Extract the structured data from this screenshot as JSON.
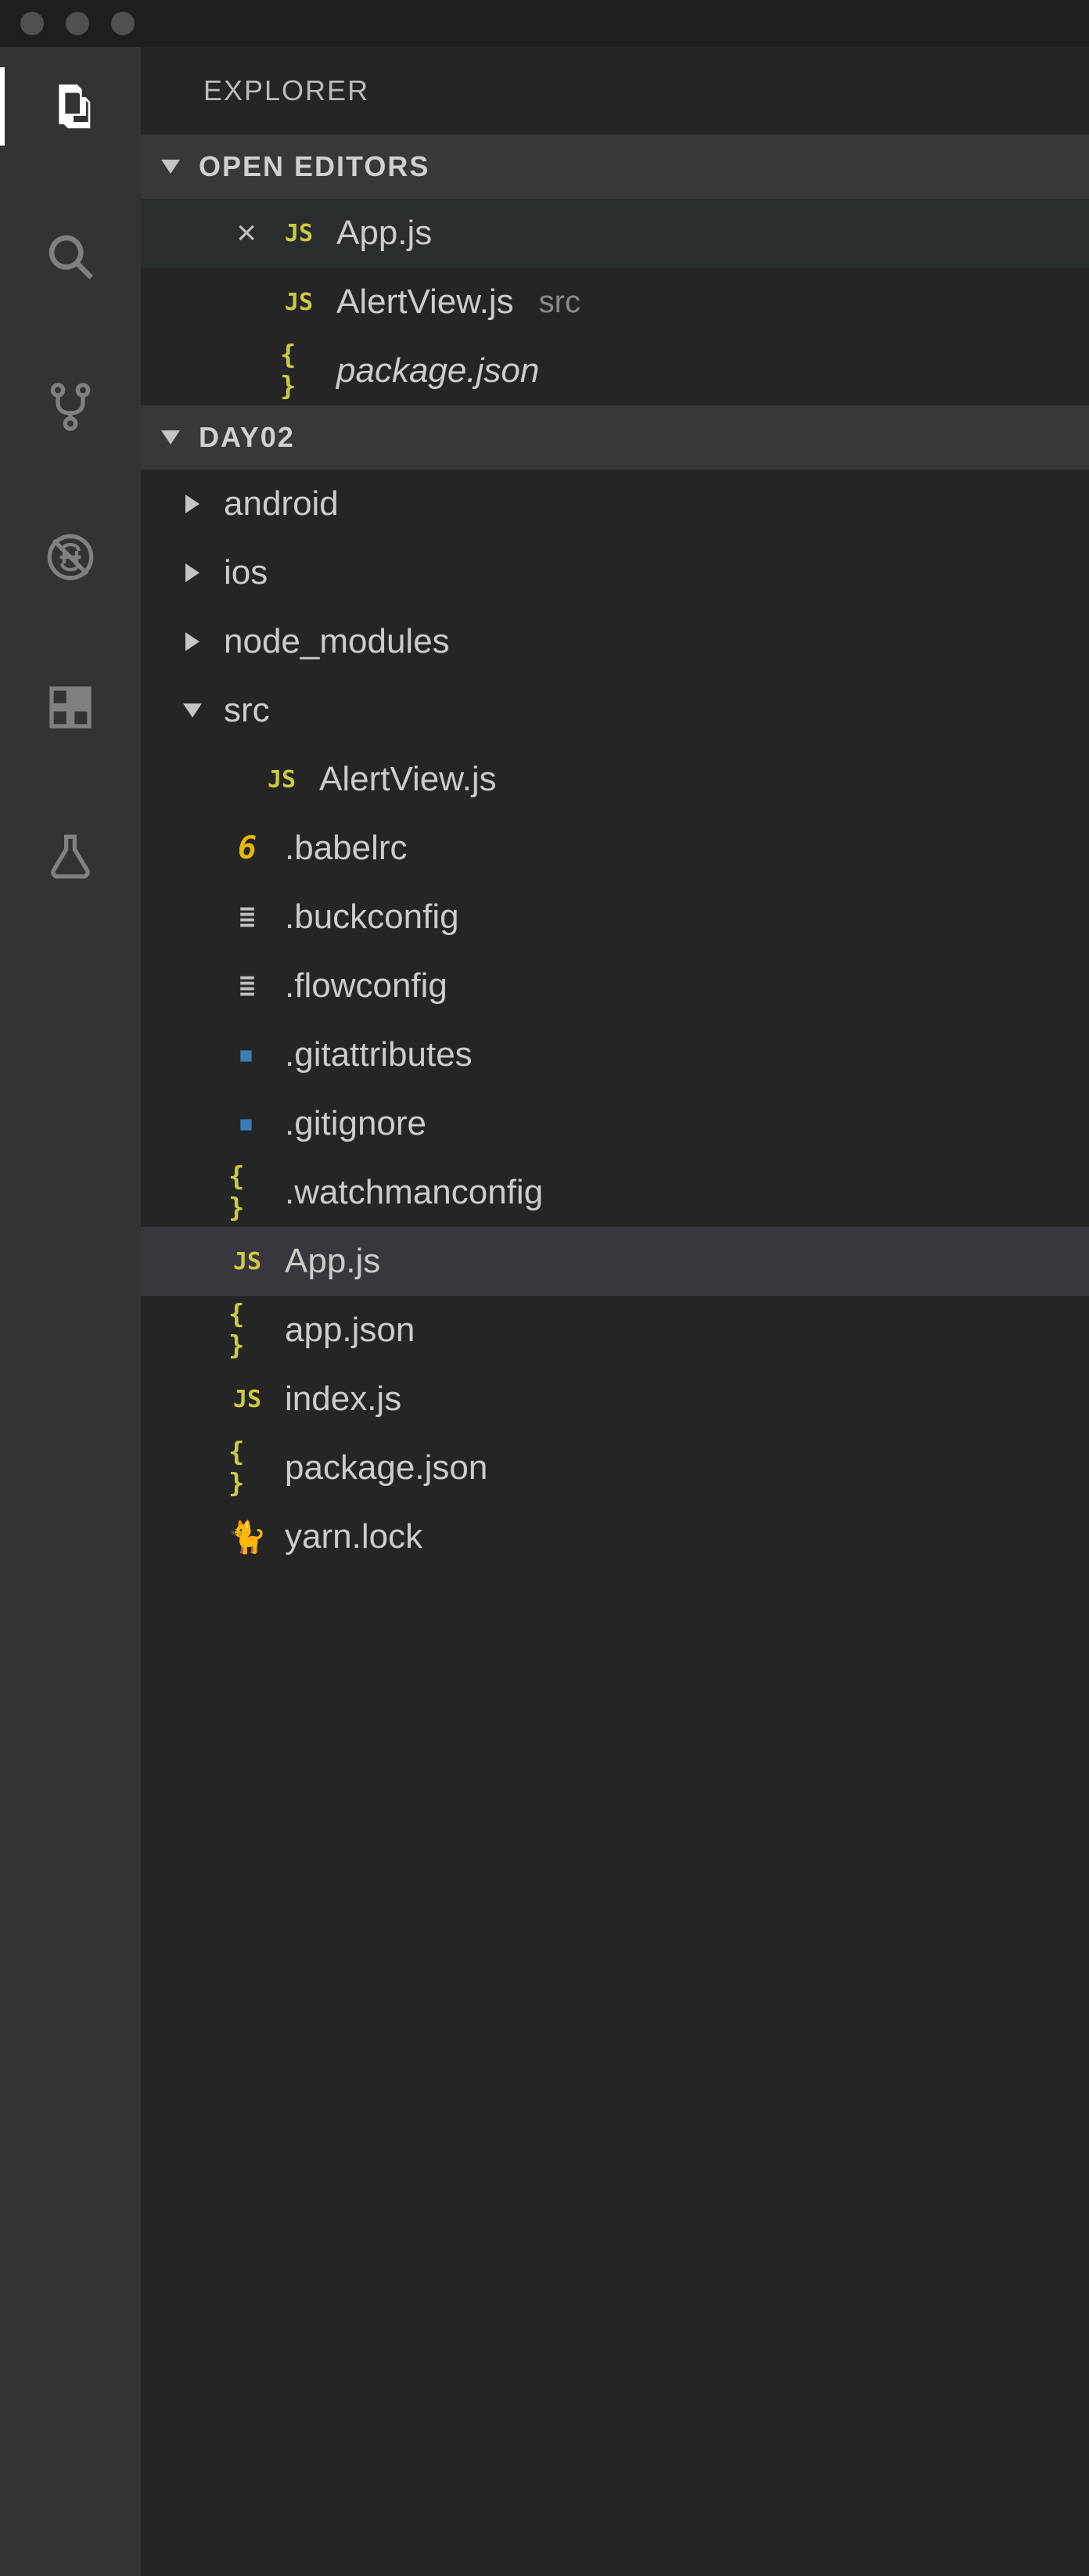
{
  "titlebar": {
    "title": ""
  },
  "activitybar": {
    "items": [
      {
        "name": "explorer",
        "active": true
      },
      {
        "name": "search",
        "active": false
      },
      {
        "name": "source-control",
        "active": false
      },
      {
        "name": "debug",
        "active": false
      },
      {
        "name": "extensions",
        "active": false
      },
      {
        "name": "beaker",
        "active": false
      }
    ]
  },
  "sidebar": {
    "title": "EXPLORER",
    "openEditors": {
      "label": "OPEN EDITORS",
      "items": [
        {
          "icon": "js",
          "name": "App.js",
          "dir": "",
          "dirty": false,
          "active": true,
          "italic": false
        },
        {
          "icon": "js",
          "name": "AlertView.js",
          "dir": "src",
          "dirty": false,
          "active": false,
          "italic": false
        },
        {
          "icon": "json",
          "name": "package.json",
          "dir": "",
          "dirty": false,
          "active": false,
          "italic": true
        }
      ]
    },
    "project": {
      "label": "DAY02",
      "tree": [
        {
          "type": "folder",
          "name": "android",
          "expanded": false,
          "depth": 0
        },
        {
          "type": "folder",
          "name": "ios",
          "expanded": false,
          "depth": 0
        },
        {
          "type": "folder",
          "name": "node_modules",
          "expanded": false,
          "depth": 0
        },
        {
          "type": "folder",
          "name": "src",
          "expanded": true,
          "depth": 0
        },
        {
          "type": "file",
          "name": "AlertView.js",
          "icon": "js",
          "depth": 1,
          "selected": false
        },
        {
          "type": "file",
          "name": ".babelrc",
          "icon": "babel",
          "depth": 0,
          "selected": false
        },
        {
          "type": "file",
          "name": ".buckconfig",
          "icon": "lines",
          "depth": 0,
          "selected": false
        },
        {
          "type": "file",
          "name": ".flowconfig",
          "icon": "lines",
          "depth": 0,
          "selected": false
        },
        {
          "type": "file",
          "name": ".gitattributes",
          "icon": "git",
          "depth": 0,
          "selected": false
        },
        {
          "type": "file",
          "name": ".gitignore",
          "icon": "git",
          "depth": 0,
          "selected": false
        },
        {
          "type": "file",
          "name": ".watchmanconfig",
          "icon": "json",
          "depth": 0,
          "selected": false
        },
        {
          "type": "file",
          "name": "App.js",
          "icon": "js",
          "depth": 0,
          "selected": true
        },
        {
          "type": "file",
          "name": "app.json",
          "icon": "json",
          "depth": 0,
          "selected": false
        },
        {
          "type": "file",
          "name": "index.js",
          "icon": "js",
          "depth": 0,
          "selected": false
        },
        {
          "type": "file",
          "name": "package.json",
          "icon": "json",
          "depth": 0,
          "selected": false
        },
        {
          "type": "file",
          "name": "yarn.lock",
          "icon": "yarn",
          "depth": 0,
          "selected": false
        }
      ]
    }
  },
  "icons": {
    "js": "JS",
    "json": "{ }",
    "babel": "6",
    "lines": "≣",
    "git": "◆",
    "yarn": "🐈",
    "close": "×"
  }
}
